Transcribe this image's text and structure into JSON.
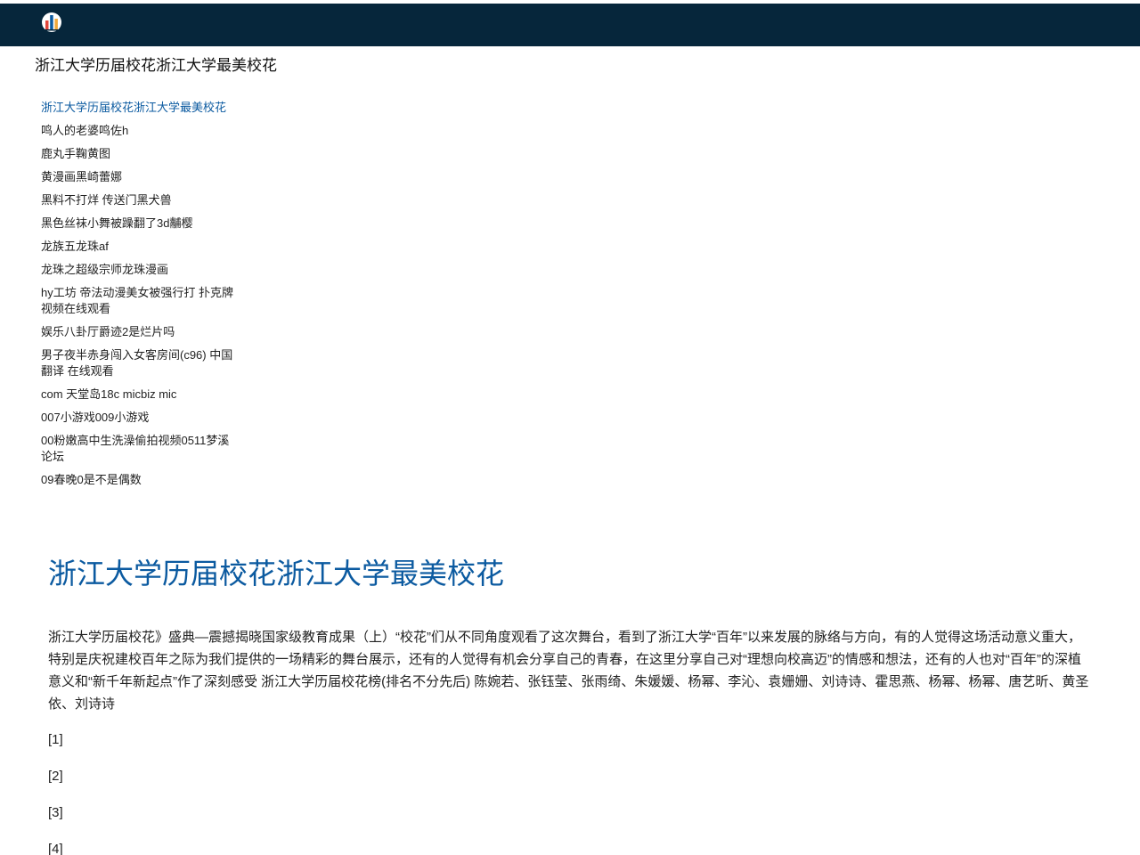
{
  "colors": {
    "topbar": "#06263b",
    "accent": "#0b5aa0"
  },
  "header": {
    "logo_icon": "chart-logo-icon"
  },
  "site_title": "浙江大学历届校花浙江大学最美校花",
  "sidebar": {
    "items": [
      "浙江大学历届校花浙江大学最美校花",
      "鸣人的老婆鸣佐h",
      "鹿丸手鞠黄图",
      "黄漫画黑崎蕾娜",
      "黑料不打烊 传送门黑犬兽",
      "黑色丝袜小舞被躁翻了3d黼樱",
      "龙族五龙珠af",
      "龙珠之超级宗师龙珠漫画",
      "hy工坊 帝法动漫美女被强行打 扑克牌 视频在线观看",
      "娱乐八卦厅爵迹2是烂片吗",
      "男子夜半赤身闯入女客房间(c96) 中国翻译 在线观看",
      "com 天堂岛18c micbiz mic",
      "007小游戏009小游戏",
      "00粉嫩高中生洗澡偷拍视频0511梦溪论坛",
      "09春晚0是不是偶数"
    ]
  },
  "main": {
    "title": "浙江大学历届校花浙江大学最美校花",
    "body": "浙江大学历届校花》盛典—震撼揭晓国家级教育成果（上）“校花”们从不同角度观看了这次舞台，看到了浙江大学“百年”以来发展的脉络与方向，有的人觉得这场活动意义重大，特别是庆祝建校百年之际为我们提供的一场精彩的舞台展示，还有的人觉得有机会分享自己的青春，在这里分享自己对“理想向校高迈”的情感和想法，还有的人也对“百年”的深植意义和“新千年新起点”作了深刻感受 浙江大学历届校花榜(排名不分先后) 陈婉若、张钰莹、张雨绮、朱媛媛、杨幂、李沁、袁姗姗、刘诗诗、霍思燕、杨幂、杨幂、唐艺昕、黄圣依、刘诗诗",
    "refs": [
      "[1]",
      "[2]",
      "[3]",
      "[4]"
    ]
  }
}
